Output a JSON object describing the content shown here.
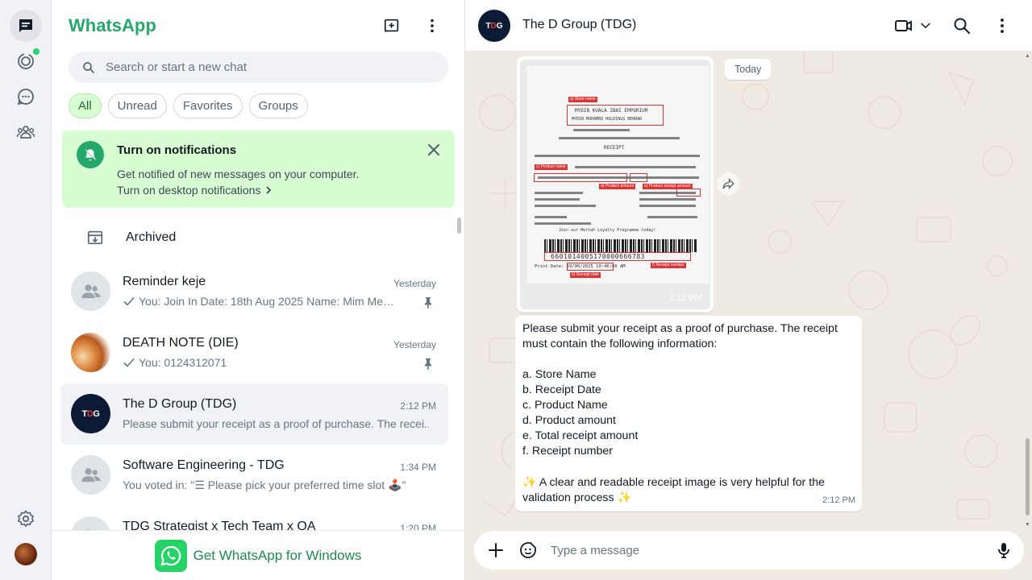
{
  "app": {
    "title": "WhatsApp"
  },
  "search": {
    "placeholder": "Search or start a new chat"
  },
  "filters": [
    "All",
    "Unread",
    "Favorites",
    "Groups"
  ],
  "notification": {
    "title": "Turn on notifications",
    "description": "Get notified of new messages on your computer.",
    "link": "Turn on desktop notifications"
  },
  "archived": {
    "label": "Archived"
  },
  "chats": [
    {
      "name": "Reminder keje",
      "time": "Yesterday",
      "preview": "You: Join In Date: 18th  Aug 2025 Name: Mim Melia ...",
      "pinned": true
    },
    {
      "name": "DEATH NOTE (DIE)",
      "time": "Yesterday",
      "preview": "You: 0124312071",
      "pinned": true
    },
    {
      "name": "The D Group (TDG)",
      "time": "2:12 PM",
      "preview": "Please submit your receipt as a proof of purchase. The recei...",
      "selected": true
    },
    {
      "name": "Software Engineering - TDG",
      "time": "1:34 PM",
      "preview": "You voted in: \"☰ Please pick your preferred time slot 🕹️\""
    },
    {
      "name": "TDG Strategist x Tech Team x QA",
      "time": "1:20 PM",
      "preview": ""
    }
  ],
  "get_windows": {
    "label": "Get WhatsApp for Windows"
  },
  "conversation": {
    "title": "The D Group (TDG)",
    "avatar_text": "TDG",
    "date_divider": "Today",
    "image_message": {
      "time": "2:12 PM",
      "receipt_tags": {
        "store_name": "a) Store name",
        "product_name": "c) Product name",
        "product_amount": "d) Product amount",
        "receipt_amount": "e) Product receipt amount",
        "receipt_number": "f) Receipt number",
        "receipt_date": "b) Receipt date"
      },
      "receipt_text": {
        "store": "MYDIN KUALA IBAI EMPORIUM",
        "company": "MYDIN MOHAMED HOLDINGS BERHAD",
        "receipt": "RECEIPT",
        "loyalty": "Join our Mertah Loyalty Programme today!",
        "barcode_number": "6601014005170000666783",
        "print_date": "Print Date: 19/06/2025 10:46:06 AM"
      }
    },
    "text_message": {
      "lines": [
        "Please submit your receipt as a proof of purchase. The receipt",
        "must contain the following information:",
        "",
        "a. Store Name",
        "b. Receipt Date",
        "c. Product Name",
        "d. Product amount",
        "e. Total receipt amount",
        "f. Receipt number",
        "",
        "✨ A clear and readable receipt image is very helpful for the",
        "validation process ✨"
      ],
      "time": "2:12 PM"
    },
    "composer": {
      "placeholder": "Type a message"
    }
  },
  "colors": {
    "brand": "#25a86b",
    "accent_green": "#25d366",
    "chip_active_bg": "#d9fdd3",
    "conversation_bg": "#efeae2"
  },
  "icons": [
    "chats-icon",
    "status-icon",
    "channels-icon",
    "communities-icon",
    "settings-icon",
    "new-chat-icon",
    "menu-icon",
    "search-icon",
    "bell-off-icon",
    "close-icon",
    "archive-icon",
    "pin-icon",
    "check-icon",
    "video-call-icon",
    "chevron-down-icon",
    "forward-icon",
    "plus-icon",
    "sticker-icon",
    "mic-icon"
  ]
}
